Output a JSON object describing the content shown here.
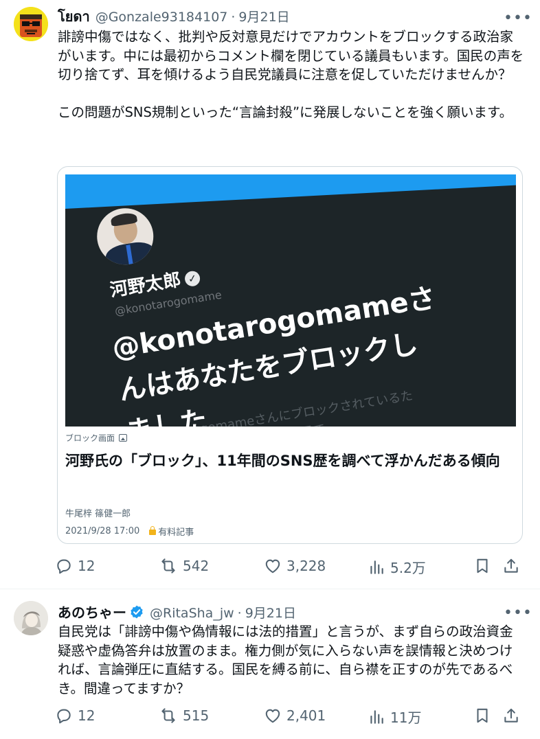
{
  "tweets": [
    {
      "display_name": "โยดา",
      "handle": "@Gonzale93184107",
      "date": "9月21日",
      "verified": false,
      "text": "誹謗中傷ではなく、批判や反対意見だけでアカウントをブロックする政治家がいます。中には最初からコメント欄を閉じている議員もいます。国民の声を切り捨てず、耳を傾けるよう自民党議員に注意を促していただけませんか？\n\nこの問題がSNS規制といった“言論封殺”に発展しないことを強く願います。",
      "card": {
        "image_name": "河野太郎",
        "image_handle": "@konotarogomame",
        "image_message": "@konotarogomameさ\nんはあなたをブロックし\nました",
        "image_faint": "rogomameさんにブロックされているた\nさんのツイートを表示で",
        "source_label": "ブロック画面",
        "title": "河野氏の「ブロック」、11年間のSNS歴を調べて浮かんだある傾向",
        "author": "牛尾梓 篠健一郎",
        "timestamp": "2021/9/28 17:00",
        "paid_label": "有料記事"
      },
      "stats": {
        "replies": "12",
        "reposts": "542",
        "likes": "3,228",
        "views": "5.2万"
      }
    },
    {
      "display_name": "あのちゃー",
      "handle": "@RitaSha_jw",
      "date": "9月21日",
      "verified": true,
      "text": "自民党は「誹謗中傷や偽情報には法的措置」と言うが、まず自らの政治資金疑惑や虚偽答弁は放置のまま。権力側が気に入らない声を誤情報と決めつければ、言論弾圧に直結する。国民を縛る前に、自ら襟を正すのが先であるべき。間違ってますか？",
      "stats": {
        "replies": "12",
        "reposts": "515",
        "likes": "2,401",
        "views": "11万"
      }
    }
  ],
  "separator": "·",
  "more_glyph": "•••",
  "colors": {
    "text": "#0f1419",
    "secondary": "#536471",
    "verified": "#1d9bf0",
    "border": "#cfd9de"
  }
}
